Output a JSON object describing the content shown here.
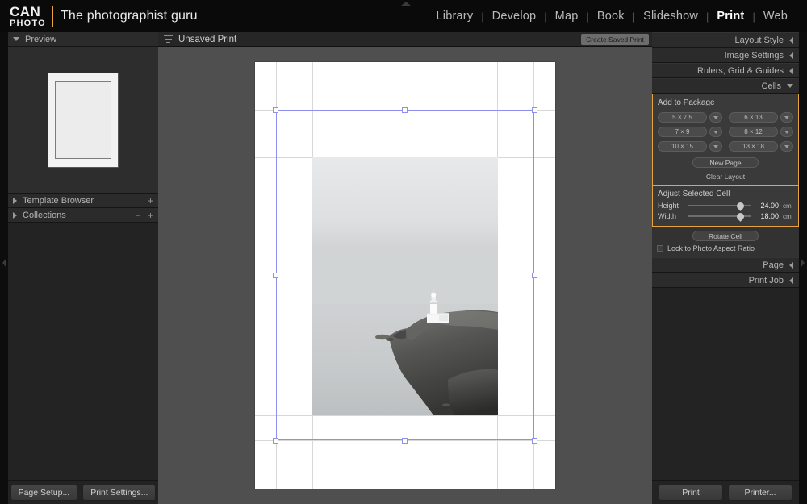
{
  "brand": {
    "logo_line1": "CAN",
    "logo_line2": "PHOTO",
    "tagline": "The photographist guru",
    "accent": "#e8a33d"
  },
  "mainnav": {
    "items": [
      {
        "label": "Library",
        "active": false
      },
      {
        "label": "Develop",
        "active": false
      },
      {
        "label": "Map",
        "active": false
      },
      {
        "label": "Book",
        "active": false
      },
      {
        "label": "Slideshow",
        "active": false
      },
      {
        "label": "Print",
        "active": true
      },
      {
        "label": "Web",
        "active": false
      }
    ],
    "separator": "|"
  },
  "left_panel": {
    "preview": {
      "title": "Preview",
      "state": "expanded"
    },
    "template_browser": {
      "title": "Template Browser",
      "plus": "+"
    },
    "collections": {
      "title": "Collections",
      "minus": "−",
      "plus": "+"
    },
    "buttons": {
      "page_setup": "Page Setup...",
      "print_settings": "Print Settings..."
    }
  },
  "toolbar": {
    "title": "Unsaved Print",
    "create_saved_print": "Create Saved Print"
  },
  "right_panel": {
    "sections": [
      {
        "label": "Layout Style",
        "state": "collapsed"
      },
      {
        "label": "Image Settings",
        "state": "collapsed"
      },
      {
        "label": "Rulers, Grid & Guides",
        "state": "collapsed"
      },
      {
        "label": "Cells",
        "state": "expanded"
      }
    ],
    "cells": {
      "add_to_package_label": "Add to Package",
      "sizes": [
        "5 × 7.5",
        "6 × 13",
        "7 × 9",
        "8 × 12",
        "10 × 15",
        "13 × 18"
      ],
      "new_page": "New Page",
      "clear_layout": "Clear Layout"
    },
    "adjust_selected_cell": {
      "label": "Adjust Selected Cell",
      "height_label": "Height",
      "height_value": "24.00",
      "height_unit": "cm",
      "width_label": "Width",
      "width_value": "18.00",
      "width_unit": "cm",
      "rotate_cell": "Rotate Cell",
      "lock_aspect_label": "Lock to Photo Aspect Ratio",
      "lock_aspect_checked": false
    },
    "page_section": {
      "label": "Page",
      "state": "collapsed"
    },
    "print_job_section": {
      "label": "Print Job",
      "state": "collapsed"
    },
    "buttons": {
      "print": "Print",
      "printer": "Printer..."
    }
  },
  "canvas": {
    "page_color": "#ffffff",
    "backdrop_color": "#4f4f4f",
    "selection_color": "#8f8ff0",
    "photo_description": "Black and white long-exposure photograph of a white lighthouse on a dark rocky headland with calm misty sea"
  }
}
